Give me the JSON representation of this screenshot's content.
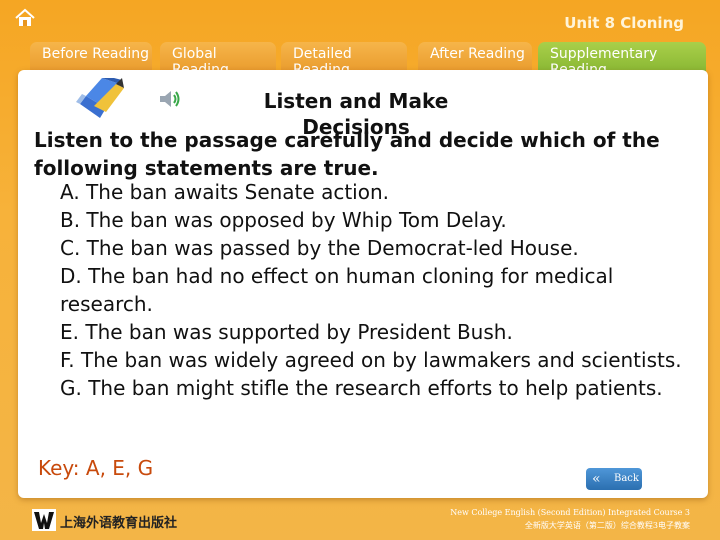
{
  "header": {
    "unit_title": "Unit 8 Cloning",
    "tabs": [
      {
        "label": "Before Reading"
      },
      {
        "label": "Global Reading"
      },
      {
        "label": "Detailed Reading"
      },
      {
        "label": "After Reading"
      },
      {
        "label": "Supplementary Reading"
      }
    ],
    "active_tab": "Supplementary Reading",
    "colors": {
      "tab": "#eea23a",
      "active_tab": "#8fbd36",
      "background": "#f5a623"
    }
  },
  "content": {
    "icons": {
      "home": "home-icon",
      "pencil": "pencil-icon",
      "speaker": "speaker-icon"
    },
    "section_title": "Listen and Make Decisions",
    "instruction": "Listen to the passage carefully and decide which of the following statements are true.",
    "options": [
      "A. The ban awaits Senate action.",
      "B. The ban was opposed by Whip Tom Delay.",
      "C. The ban was passed by the Democrat-led House.",
      "D. The ban had no effect on human cloning for medical research.",
      "E. The ban was supported by President Bush.",
      "F. The ban was widely agreed on by lawmakers and scientists.",
      "G. The ban might stifle the research efforts to help patients."
    ],
    "key": "Key: A, E, G"
  },
  "navigation": {
    "back_label": "Back",
    "back_icon": "double-chevron-left-icon"
  },
  "footer": {
    "publisher": "上海外语教育出版社",
    "course_en": "New College English (Second Edition) Integrated Course 3",
    "course_cn": "全新版大学英语（第二版）综合教程3电子教案"
  }
}
